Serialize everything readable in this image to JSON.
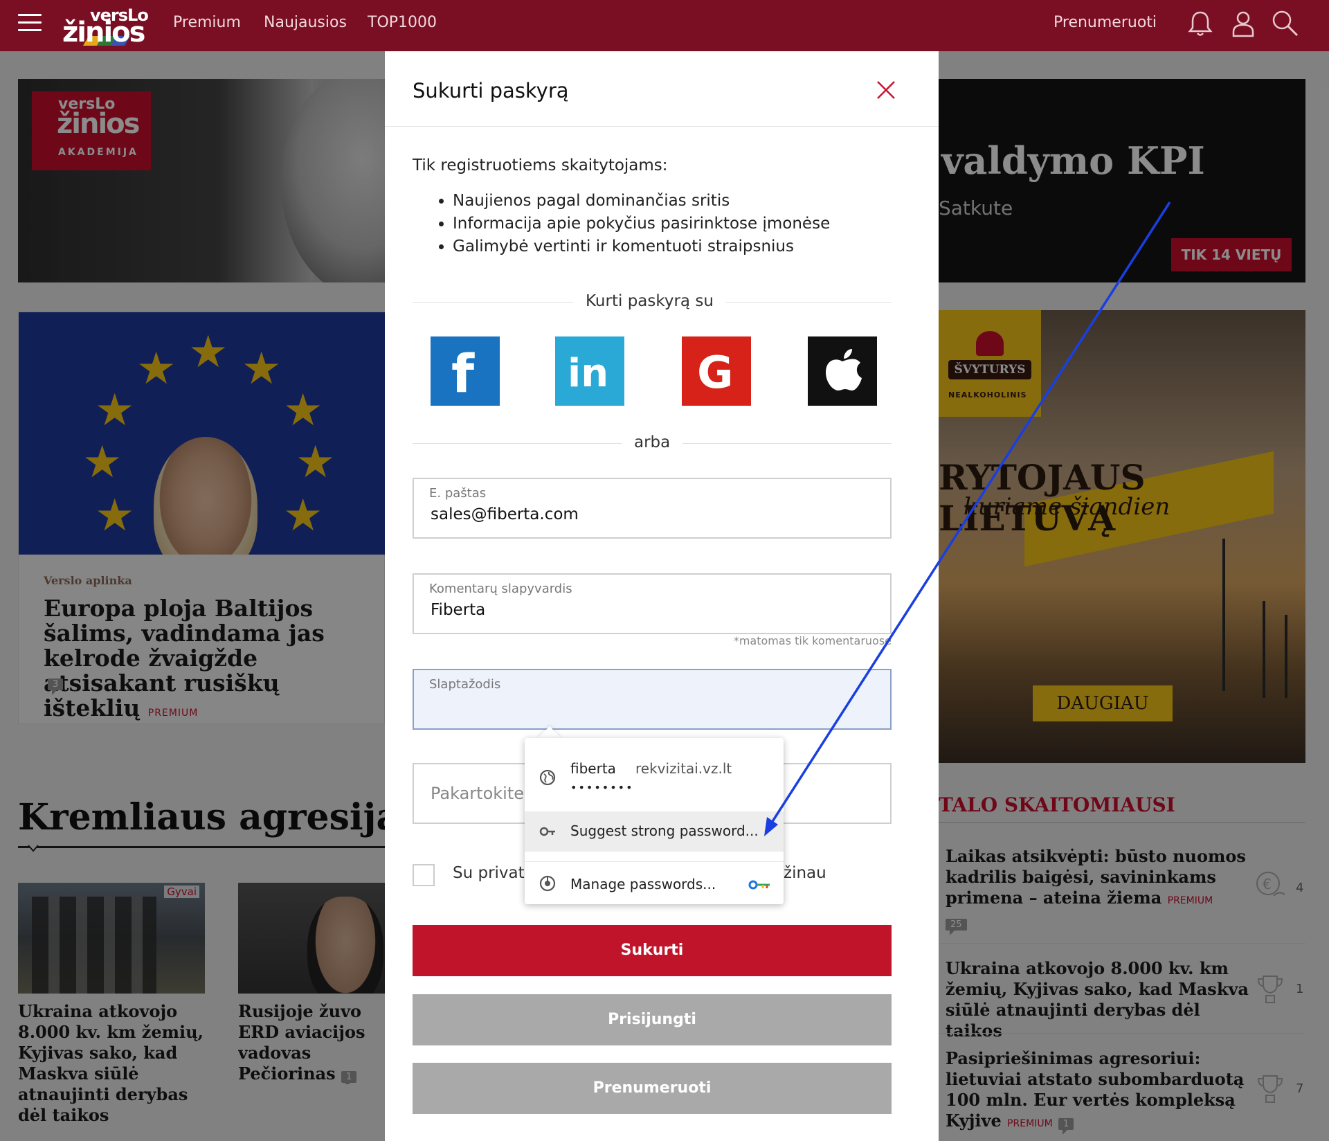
{
  "header": {
    "logo_top": "versLo",
    "logo_bottom": "žinios",
    "nav": [
      "Premium",
      "Naujausios",
      "TOP1000"
    ],
    "subscribe": "Prenumeruoti"
  },
  "left": {
    "akademija": {
      "top": "versLo",
      "mid": "žinios",
      "bottom": "AKADEMIJA"
    },
    "card": {
      "category": "Verslo aplinka",
      "title": "Europa ploja Baltijos šalims, vadindama jas kelrode žvaigžde atsisakant rusiškų išteklių",
      "badge": "PREMIUM",
      "comments": "3"
    },
    "section_title": "Kremliaus agresija",
    "section_arrow": "»",
    "thumb1_tag": "Gyvai",
    "thumb1_caption": "Ukraina atkovojo 8.000 kv. km žemių, Kyjivas sako, kad Maskva siūlė atnaujinti derybas dėl taikos",
    "thumb2_caption": "Rusijoje žuvo ERD aviacijos vadovas Pečiorinas",
    "thumb2_comments": "1"
  },
  "right": {
    "banner_title": "valdymo KPI",
    "banner_sub": "Satkute",
    "banner_button": "TIK 14 VIETŲ",
    "ad_brand": "ŠVYTURYS",
    "ad_brand_sub": "NEALKOHOLINIS",
    "ad_headline": "RYTOJAUS LIETUVĄ",
    "ad_subline": "kuriame šiandien",
    "ad_button": "DAUGIAU",
    "most_read_title": "TALO SKAITOMIAUSI",
    "most_read": [
      {
        "title": "Laikas atsikvėpti: būsto nuomos kadrilis baigėsi, savininkams primena – ateina žiema",
        "badge": "PREMIUM",
        "comments": "25",
        "count": "4",
        "icon": "money-icon"
      },
      {
        "title": "Ukraina atkovojo 8.000 kv. km žemių, Kyjivas sako, kad Maskva siūlė atnaujinti derybas dėl taikos",
        "badge": "",
        "comments": "",
        "count": "1",
        "icon": "trophy-icon"
      },
      {
        "title": "Pasipriešinimas agresoriui: lietuviai atstato subombarduotą 100 mln. Eur vertės kompleksą Kyjive",
        "badge": "PREMIUM",
        "comments": "1",
        "count": "7",
        "icon": "trophy-icon"
      }
    ]
  },
  "modal": {
    "title": "Sukurti paskyrą",
    "intro": "Tik registruotiems skaitytojams:",
    "benefits": [
      "Naujienos pagal dominančias sritis",
      "Informacija apie pokyčius pasirinktose įmonėse",
      "Galimybė vertinti ir komentuoti straipsnius"
    ],
    "social_divider": "Kurti paskyrą su",
    "or_divider": "arba",
    "email_label": "E. paštas",
    "email_value": "sales@fiberta.com",
    "nick_label": "Komentarų slapyvardis",
    "nick_value": "Fiberta",
    "nick_note": "*matomas tik komentaruose",
    "password_label": "Slaptažodis",
    "password_repeat_placeholder": "Pakartokite",
    "terms_label_start": "Su privatu",
    "terms_label_end": "žinau",
    "create_button": "Sukurti",
    "login_button": "Prisijungti",
    "subscribe_button": "Prenumeruoti"
  },
  "password_popup": {
    "account_user": "fiberta",
    "account_site": "rekvizitai.vz.lt",
    "account_mask": "••••••••",
    "suggest": "Suggest strong password...",
    "manage": "Manage passwords..."
  },
  "colors": {
    "header_bg": "#7a0f24",
    "primary_red": "#c0142a",
    "button_gray": "#a9a9a9",
    "annotation_arrow": "#1a3fe0",
    "facebook": "#1a73c0",
    "linkedin": "#2aa8d6",
    "google": "#d62218",
    "apple": "#111111"
  }
}
